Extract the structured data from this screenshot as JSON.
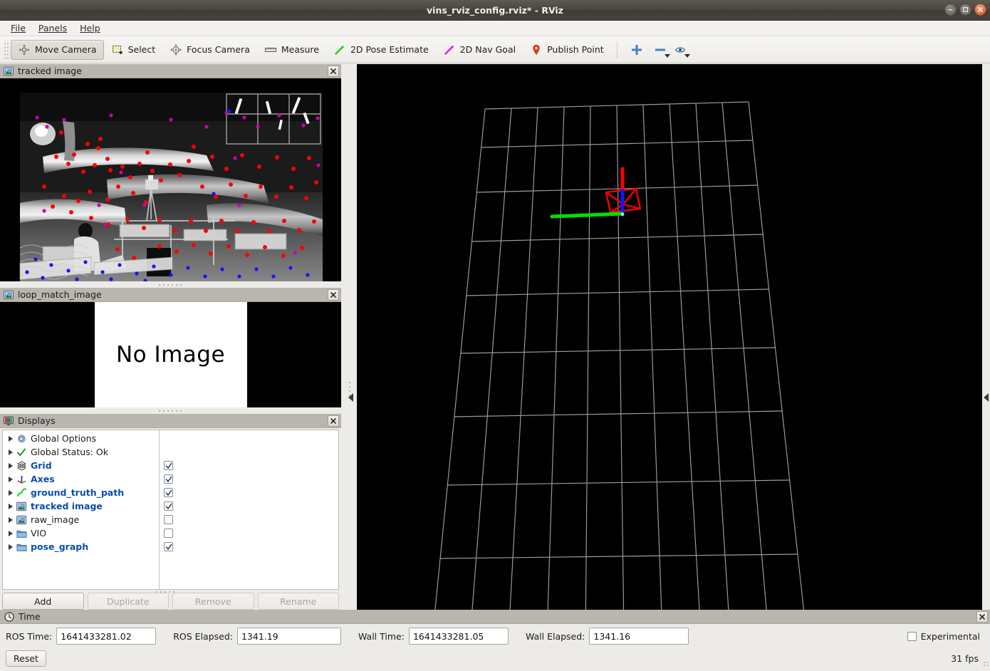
{
  "window": {
    "title": "vins_rviz_config.rviz* - RViz",
    "buttons": {
      "minimize": "–",
      "maximize": "□",
      "close": "✕"
    }
  },
  "menubar": [
    {
      "id": "file",
      "label": "File",
      "mnemonic": "F"
    },
    {
      "id": "panels",
      "label": "Panels",
      "mnemonic": "P"
    },
    {
      "id": "help",
      "label": "Help",
      "mnemonic": "H"
    }
  ],
  "toolbar": {
    "items": [
      {
        "id": "move-camera",
        "label": "Move Camera",
        "icon": "move-camera-icon",
        "active": true
      },
      {
        "id": "select",
        "label": "Select",
        "icon": "select-icon",
        "active": false
      },
      {
        "id": "focus-camera",
        "label": "Focus Camera",
        "icon": "focus-camera-icon",
        "active": false
      },
      {
        "id": "measure",
        "label": "Measure",
        "icon": "ruler-icon",
        "active": false
      },
      {
        "id": "pose-estimate",
        "label": "2D Pose Estimate",
        "icon": "green-arrow-icon",
        "active": false
      },
      {
        "id": "nav-goal",
        "label": "2D Nav Goal",
        "icon": "magenta-arrow-icon",
        "active": false
      },
      {
        "id": "publish-point",
        "label": "Publish Point",
        "icon": "map-pin-icon",
        "active": false
      }
    ],
    "tools": [
      {
        "id": "add-tool",
        "icon": "plus-icon"
      },
      {
        "id": "remove-tool",
        "icon": "minus-icon"
      },
      {
        "id": "visibility-tool",
        "icon": "eye-icon"
      }
    ]
  },
  "panels": {
    "tracked_image": {
      "title": "tracked image",
      "icon": "image-display-icon",
      "close": "✖"
    },
    "loop_match_image": {
      "title": "loop_match_image",
      "icon": "image-display-icon",
      "close": "✖",
      "placeholder": "No Image"
    },
    "displays": {
      "title": "Displays",
      "icon": "displays-icon",
      "close": "✖",
      "tree": [
        {
          "label": "Global Options",
          "icon": "gear-icon",
          "bold": false,
          "checkbox": null
        },
        {
          "label": "Global Status: Ok",
          "icon": "check-icon",
          "bold": false,
          "checkbox": null
        },
        {
          "label": "Grid",
          "icon": "grid-icon",
          "bold": true,
          "checkbox": true
        },
        {
          "label": "Axes",
          "icon": "axes-icon",
          "bold": true,
          "checkbox": true
        },
        {
          "label": "ground_truth_path",
          "icon": "path-icon",
          "bold": true,
          "checkbox": true
        },
        {
          "label": "tracked image",
          "icon": "image-display-icon",
          "bold": true,
          "checkbox": true
        },
        {
          "label": "raw_image",
          "icon": "image-display-icon",
          "bold": false,
          "checkbox": false
        },
        {
          "label": "VIO",
          "icon": "folder-icon",
          "bold": false,
          "checkbox": false
        },
        {
          "label": "pose_graph",
          "icon": "folder-icon",
          "bold": true,
          "checkbox": true
        }
      ],
      "buttons": [
        {
          "id": "add",
          "label": "Add",
          "disabled": false
        },
        {
          "id": "duplicate",
          "label": "Duplicate",
          "disabled": true
        },
        {
          "id": "remove",
          "label": "Remove",
          "disabled": true
        },
        {
          "id": "rename",
          "label": "Rename",
          "disabled": true
        }
      ]
    },
    "time": {
      "title": "Time",
      "icon": "clock-icon",
      "close": "✖",
      "fields": [
        {
          "id": "ros-time",
          "label": "ROS Time:",
          "value": "1641433281.02"
        },
        {
          "id": "ros-elapsed",
          "label": "ROS Elapsed:",
          "value": "1341.19"
        },
        {
          "id": "wall-time",
          "label": "Wall Time:",
          "value": "1641433281.05"
        },
        {
          "id": "wall-elapsed",
          "label": "Wall Elapsed:",
          "value": "1341.16"
        }
      ],
      "experimental_label": "Experimental",
      "experimental_checked": false,
      "reset_label": "Reset",
      "fps": "31 fps"
    }
  },
  "render_view": {
    "background_color": "#000000",
    "grid": {
      "rows": 10,
      "cols": 10,
      "color": "#9e9e9e"
    },
    "axes": {
      "x_color": "#ff0000",
      "y_color": "#00ff00",
      "z_color": "#0000ff"
    },
    "camera_marker_color": "#ff0000"
  },
  "colors": {
    "titlebar": "#45433c",
    "panel_header": "#b9b6b0",
    "chrome": "#ecebe7",
    "link_blue": "#0d4ea8",
    "close_orange": "#dd4814"
  }
}
